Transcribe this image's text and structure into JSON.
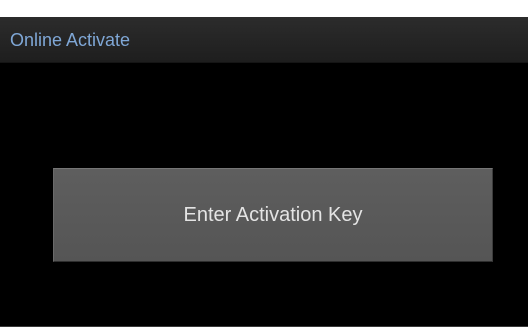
{
  "dialog": {
    "title": "Online Activate",
    "action_button_label": "Enter Activation Key"
  },
  "colors": {
    "title_text": "#7fa7d6",
    "button_text": "#e4e4e4",
    "dialog_background": "#000000",
    "button_background": "#595959"
  }
}
